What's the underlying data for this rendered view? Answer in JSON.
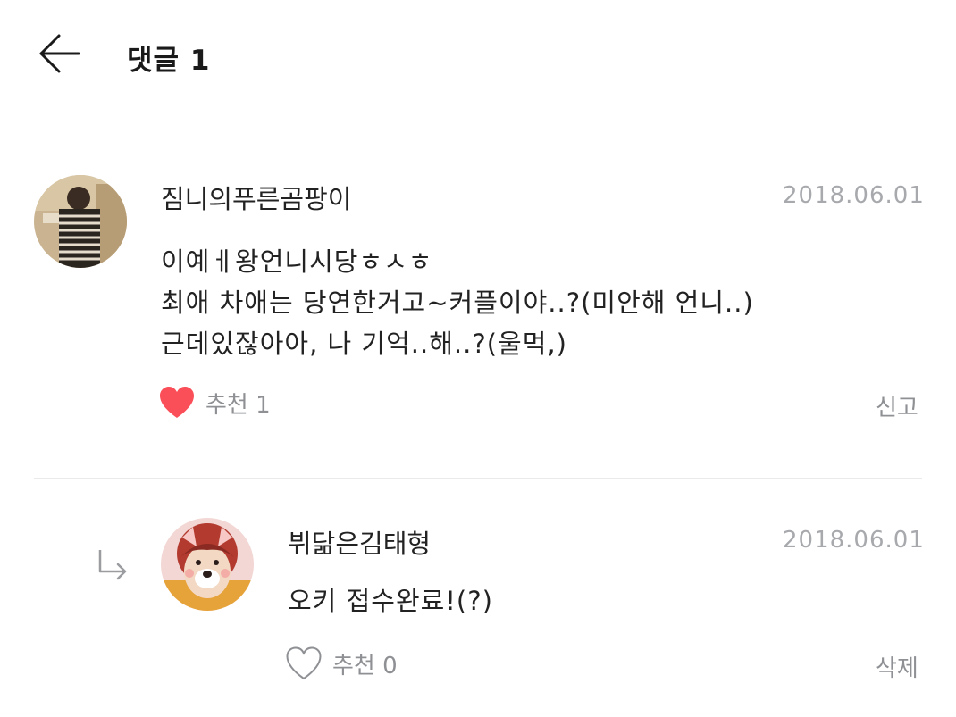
{
  "header": {
    "title": "댓글 1",
    "back_icon": "arrow-left-icon"
  },
  "comments": [
    {
      "author": "짐니의푸른곰팡이",
      "date": "2018.06.01",
      "lines": [
        "이예ㅔ왕언니시당ㅎㅅㅎ",
        "최애 차애는 당연한거고~커플이야..?(미안해 언니..)",
        "근데있잖아아, 나 기억..해..?(울먹,)"
      ],
      "like_label": "추천 1",
      "liked": true,
      "heart_color": "#fa4f58",
      "action_label": "신고"
    }
  ],
  "reply": {
    "author": "뷔닮은김태형",
    "date": "2018.06.01",
    "lines": [
      "오키 접수완료!(?)"
    ],
    "like_label": "추천 0",
    "liked": false,
    "action_label": "삭제"
  }
}
